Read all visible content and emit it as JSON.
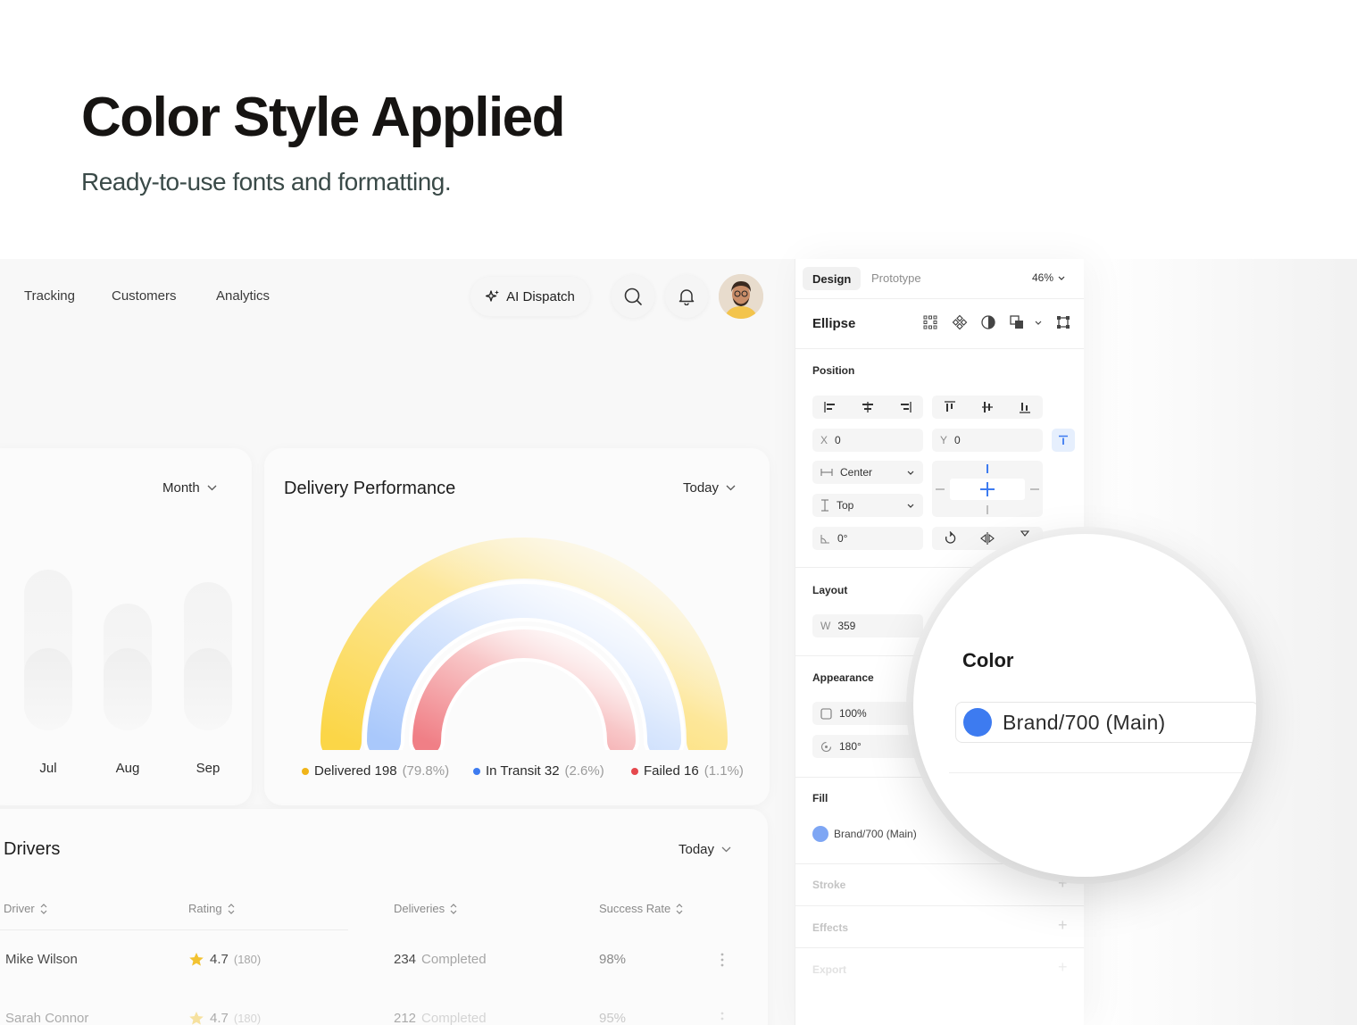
{
  "hero": {
    "title": "Color Style Applied",
    "subtitle": "Ready-to-use fonts and formatting."
  },
  "nav": {
    "links": [
      "Tracking",
      "Customers",
      "Analytics"
    ],
    "ai_button": "AI Dispatch"
  },
  "month_chart": {
    "selector": "Month",
    "months": [
      "Jul",
      "Aug",
      "Sep"
    ]
  },
  "delivery": {
    "title": "Delivery Performance",
    "selector": "Today",
    "legend": [
      {
        "label": "Delivered 198",
        "pct": "(79.8%)",
        "color": "#f0b419"
      },
      {
        "label": "In Transit 32",
        "pct": "(2.6%)",
        "color": "#3d7bf0"
      },
      {
        "label": "Failed 16",
        "pct": "(1.1%)",
        "color": "#e5484d"
      }
    ]
  },
  "drivers": {
    "title": "Drivers",
    "selector": "Today",
    "columns": [
      "Driver",
      "Rating",
      "Deliveries",
      "Success Rate"
    ],
    "rows": [
      {
        "name": "Mike Wilson",
        "rating": "4.7",
        "reviews": "(180)",
        "deliveries": "234",
        "status": "Completed",
        "rate": "98%"
      },
      {
        "name": "Sarah Connor",
        "rating": "4.7",
        "reviews": "(180)",
        "deliveries": "212",
        "status": "Completed",
        "rate": "95%"
      }
    ]
  },
  "panel": {
    "tabs": {
      "design": "Design",
      "prototype": "Prototype"
    },
    "zoom": "46%",
    "object": "Ellipse",
    "position": {
      "label": "Position",
      "x_label": "X",
      "x": "0",
      "y_label": "Y",
      "y": "0",
      "horizontal": "Center",
      "vertical": "Top",
      "rotation": "0°"
    },
    "layout": {
      "label": "Layout",
      "w_label": "W",
      "w": "359"
    },
    "appearance": {
      "label": "Appearance",
      "opacity": "100%",
      "radius": "180°"
    },
    "fill": {
      "label": "Fill",
      "value": "Brand/700 (Main)",
      "color": "#7ea6f4"
    },
    "stroke": "Stroke",
    "effects": "Effects",
    "export": "Export"
  },
  "magnifier": {
    "title": "Color",
    "value": "Brand/700 (Main)",
    "color": "#3d7bf0"
  }
}
